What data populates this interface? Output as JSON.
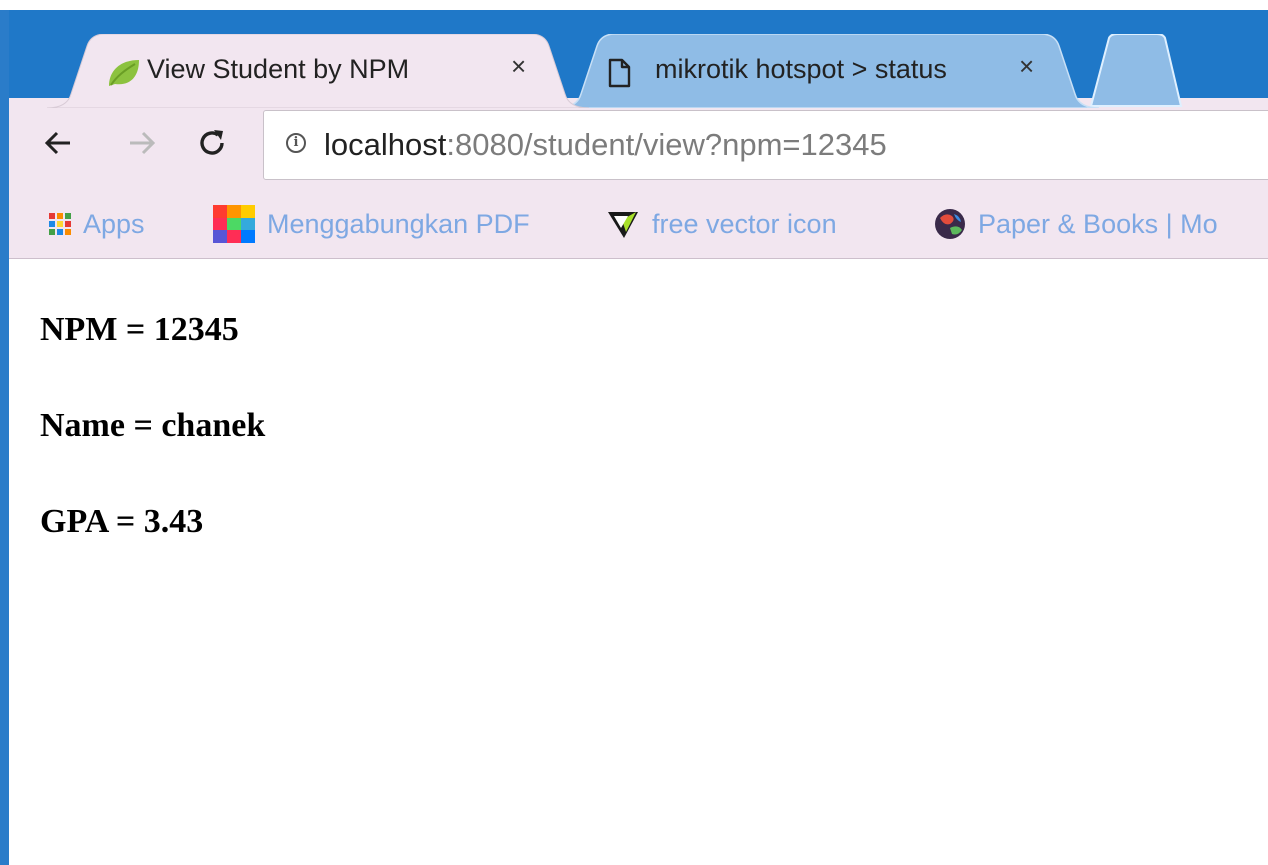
{
  "browser": {
    "tabs": [
      {
        "title": "View Student by NPM",
        "favicon": "leaf-icon",
        "close": "×",
        "active": true
      },
      {
        "title": "mikrotik hotspot > status",
        "favicon": "page-icon",
        "close": "×",
        "active": false
      }
    ],
    "new_tab_icon": "new-tab-icon",
    "nav": {
      "back": "back-arrow-icon",
      "forward": "forward-arrow-icon",
      "reload": "reload-icon"
    },
    "address": {
      "security_icon": "info-icon",
      "host": "localhost",
      "rest": ":8080/student/view?npm=12345"
    },
    "bookmarks": [
      {
        "label": "Apps",
        "icon": "apps-grid-icon"
      },
      {
        "label": "Menggabungkan PDF",
        "icon": "colorful-squares-icon"
      },
      {
        "label": "free vector icon",
        "icon": "vector-v-icon"
      },
      {
        "label": "Paper & Books | Mo",
        "icon": "paper-globe-icon"
      }
    ]
  },
  "page": {
    "npm_line": "NPM = 12345",
    "name_line": "Name = chanek",
    "gpa_line": "GPA = 3.43"
  },
  "colors": {
    "frame": "#1f78c8",
    "toolbar": "#f2e6f0",
    "active_tab": "#f2e6f0",
    "inactive_tab": "#8fbce6",
    "bookmark_text": "#7ea8e3"
  }
}
